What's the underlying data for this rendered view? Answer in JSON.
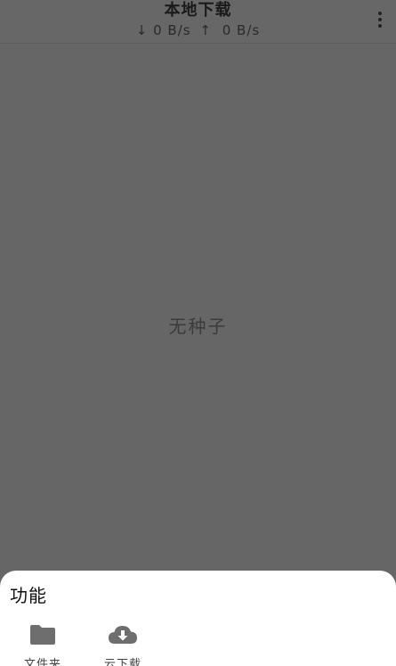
{
  "header": {
    "title": "本地下载",
    "download_arrow": "↓",
    "download_speed": "0 B/s",
    "upload_arrow": "↑",
    "upload_speed": "0 B/s",
    "menu_icon": "more-vertical-icon"
  },
  "main": {
    "empty_text": "无种子"
  },
  "sheet": {
    "title": "功能",
    "items": [
      {
        "label": "文件夹",
        "icon": "folder-icon"
      },
      {
        "label": "云下载",
        "icon": "cloud-download-icon"
      }
    ]
  },
  "colors": {
    "overlay_background": "#666666",
    "sheet_background": "#ffffff",
    "icon_gray": "#6e6e6e"
  }
}
